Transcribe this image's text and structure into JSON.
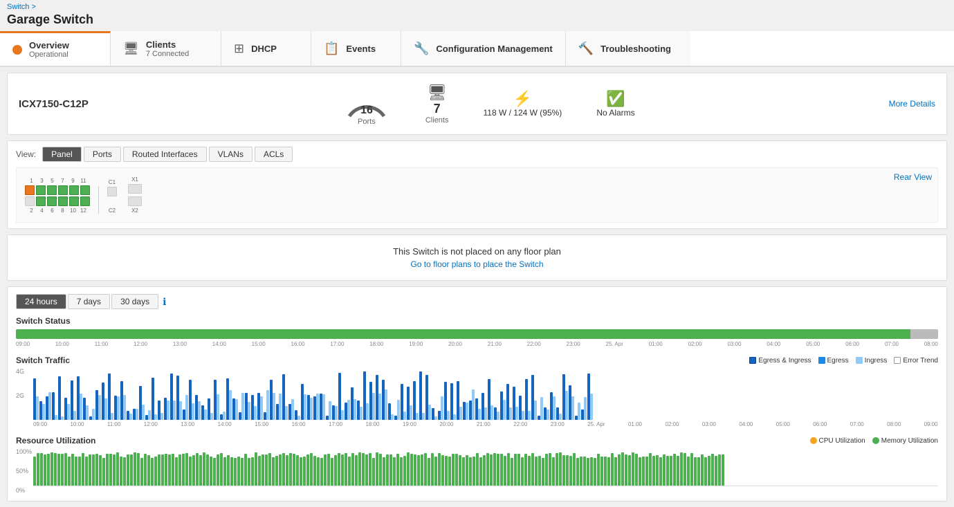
{
  "breadcrumb": "Switch >",
  "pageTitle": "Garage Switch",
  "nav": {
    "tabs": [
      {
        "id": "overview",
        "label": "Overview",
        "sublabel": "Operational",
        "icon": "location",
        "active": true
      },
      {
        "id": "clients",
        "label": "Clients",
        "sublabel": "7 Connected",
        "icon": "monitor",
        "active": false
      },
      {
        "id": "dhcp",
        "label": "DHCP",
        "sublabel": "",
        "icon": "network",
        "active": false
      },
      {
        "id": "events",
        "label": "Events",
        "sublabel": "",
        "icon": "document",
        "active": false
      },
      {
        "id": "configmgmt",
        "label": "Configuration Management",
        "sublabel": "",
        "icon": "wrench",
        "active": false
      },
      {
        "id": "troubleshooting",
        "label": "Troubleshooting",
        "sublabel": "",
        "icon": "tools",
        "active": false
      }
    ]
  },
  "device": {
    "name": "ICX7150-C12P",
    "ports": 16,
    "portsLabel": "Ports",
    "clients": 7,
    "clientsLabel": "Clients",
    "power": "118 W / 124 W (95%)",
    "alarms": "No Alarms",
    "moreDetails": "More Details"
  },
  "viewTabs": [
    "Panel",
    "Ports",
    "Routed Interfaces",
    "VLANs",
    "ACLs"
  ],
  "rearView": "Rear View",
  "floorPlan": {
    "notice": "This Switch is not placed on any floor plan",
    "link": "Go to floor plans to place the Switch"
  },
  "timeTabs": [
    "24 hours",
    "7 days",
    "30 days"
  ],
  "switchStatus": {
    "title": "Switch Status",
    "timeLabels": [
      "09:00",
      "10:00",
      "11:00",
      "12:00",
      "13:00",
      "14:00",
      "15:00",
      "16:00",
      "17:00",
      "18:00",
      "19:00",
      "20:00",
      "21:00",
      "22:00",
      "23:00",
      "25. Apr",
      "01:00",
      "02:00",
      "03:00",
      "04:00",
      "05:00",
      "06:00",
      "07:00",
      "08:00"
    ]
  },
  "switchTraffic": {
    "title": "Switch Traffic",
    "legend": {
      "egressIngress": "Egress & Ingress",
      "egress": "Egress",
      "ingress": "Ingress",
      "errorTrend": "Error Trend"
    },
    "yLabels": [
      "4G",
      "2G"
    ],
    "timeLabels": [
      "09:00",
      "10:00",
      "11:00",
      "12:00",
      "13:00",
      "14:00",
      "15:00",
      "16:00",
      "17:00",
      "18:00",
      "19:00",
      "20:00",
      "21:00",
      "22:00",
      "23:00",
      "25. Apr",
      "01:00",
      "02:00",
      "03:00",
      "04:00",
      "05:00",
      "06:00",
      "07:00",
      "08:00",
      "09:00"
    ]
  },
  "resourceUtilization": {
    "title": "Resource Utilization",
    "legend": {
      "cpu": "CPU Utilization",
      "memory": "Memory Utilization"
    },
    "yLabels": [
      "100%",
      "50%",
      "0%"
    ]
  }
}
